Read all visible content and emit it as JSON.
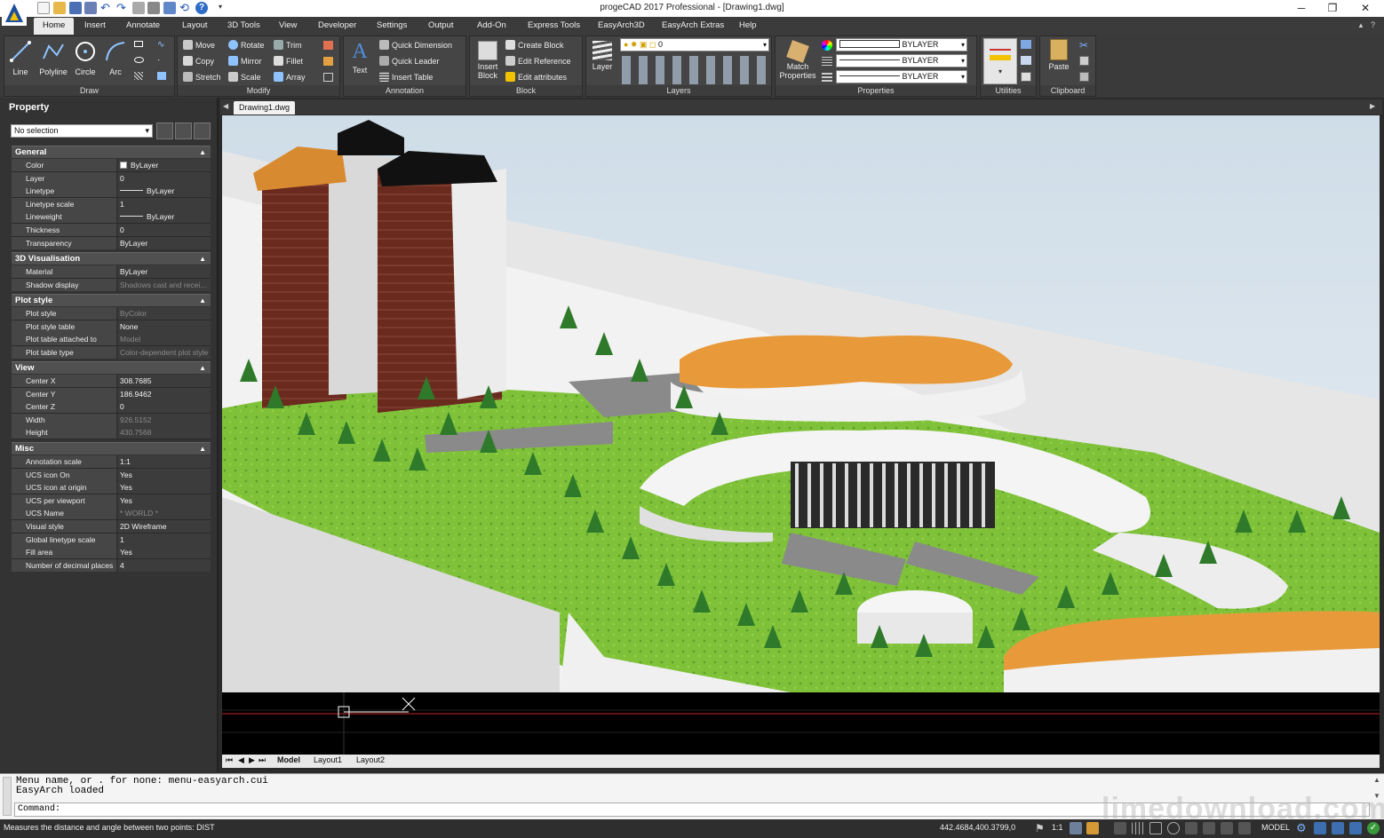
{
  "window": {
    "title": "progeCAD 2017 Professional - [Drawing1.dwg]",
    "minimize": "─",
    "restore": "❐",
    "close": "✕"
  },
  "menu": {
    "tabs": [
      {
        "label": "Home"
      },
      {
        "label": "Insert"
      },
      {
        "label": "Annotate"
      },
      {
        "label": "Layout"
      },
      {
        "label": "3D Tools"
      },
      {
        "label": "View"
      },
      {
        "label": "Developer"
      },
      {
        "label": "Settings"
      },
      {
        "label": "Output"
      },
      {
        "label": "Add-On"
      },
      {
        "label": "Express Tools"
      },
      {
        "label": "EasyArch3D"
      },
      {
        "label": "EasyArch Extras"
      },
      {
        "label": "Help"
      }
    ]
  },
  "ribbon": {
    "draw": {
      "label": "Draw",
      "line": "Line",
      "polyline": "Polyline",
      "circle": "Circle",
      "arc": "Arc"
    },
    "modify": {
      "label": "Modify",
      "move": "Move",
      "rotate": "Rotate",
      "trim": "Trim",
      "copy": "Copy",
      "mirror": "Mirror",
      "fillet": "Fillet",
      "stretch": "Stretch",
      "scale": "Scale",
      "array": "Array"
    },
    "annotation": {
      "label": "Annotation",
      "text": "Text",
      "quick_dimension": "Quick Dimension",
      "quick_leader": "Quick Leader",
      "insert_table": "Insert Table"
    },
    "block": {
      "label": "Block",
      "insert_block_1": "Insert",
      "insert_block_2": "Block",
      "create_block": "Create Block",
      "edit_reference": "Edit Reference",
      "edit_attributes": "Edit attributes"
    },
    "layers": {
      "label": "Layers",
      "layer": "Layer",
      "current_layer": "0"
    },
    "properties": {
      "label": "Properties",
      "match_1": "Match",
      "match_2": "Properties",
      "color": "BYLAYER",
      "linetype": "BYLAYER",
      "lineweight": "BYLAYER"
    },
    "utilities": {
      "label": "Utilities"
    },
    "clipboard": {
      "label": "Clipboard",
      "paste": "Paste"
    }
  },
  "property_panel": {
    "title": "Property",
    "selection": "No selection",
    "sections": {
      "general": {
        "title": "General",
        "rows": [
          {
            "k": "Color",
            "v": "ByLayer"
          },
          {
            "k": "Layer",
            "v": "0"
          },
          {
            "k": "Linetype",
            "v": "ByLayer"
          },
          {
            "k": "Linetype scale",
            "v": "1"
          },
          {
            "k": "Lineweight",
            "v": "ByLayer"
          },
          {
            "k": "Thickness",
            "v": "0"
          },
          {
            "k": "Transparency",
            "v": "ByLayer"
          }
        ]
      },
      "vis3d": {
        "title": "3D Visualisation",
        "rows": [
          {
            "k": "Material",
            "v": "ByLayer"
          },
          {
            "k": "Shadow display",
            "v": "Shadows cast and recei..."
          }
        ]
      },
      "plot": {
        "title": "Plot style",
        "rows": [
          {
            "k": "Plot style",
            "v": "ByColor"
          },
          {
            "k": "Plot style table",
            "v": "None"
          },
          {
            "k": "Plot table attached to",
            "v": "Model"
          },
          {
            "k": "Plot table type",
            "v": "Color-dependent plot style"
          }
        ]
      },
      "view": {
        "title": "View",
        "rows": [
          {
            "k": "Center X",
            "v": "308.7685"
          },
          {
            "k": "Center Y",
            "v": "186.9462"
          },
          {
            "k": "Center Z",
            "v": "0"
          },
          {
            "k": "Width",
            "v": "926.5152"
          },
          {
            "k": "Height",
            "v": "430.7568"
          }
        ]
      },
      "misc": {
        "title": "Misc",
        "rows": [
          {
            "k": "Annotation scale",
            "v": "1:1"
          },
          {
            "k": "UCS icon On",
            "v": "Yes"
          },
          {
            "k": "UCS icon at origin",
            "v": "Yes"
          },
          {
            "k": "UCS per viewport",
            "v": "Yes"
          },
          {
            "k": "UCS Name",
            "v": "* WORLD *"
          },
          {
            "k": "Visual style",
            "v": "2D Wireframe"
          },
          {
            "k": "Global linetype scale",
            "v": "1"
          },
          {
            "k": "Fill area",
            "v": "Yes"
          },
          {
            "k": "Number of decimal places",
            "v": "4"
          }
        ]
      }
    }
  },
  "document_tab": "Drawing1.dwg",
  "layout_tabs": {
    "model": "Model",
    "layout1": "Layout1",
    "layout2": "Layout2"
  },
  "command": {
    "line1": "Menu name, or . for none: menu-easyarch.cui",
    "line2": "EasyArch loaded",
    "prompt": "Command:"
  },
  "status": {
    "message": "Measures the distance and angle between two points:  DIST",
    "coords": "442.4684,400.3799,0",
    "scale": "1:1",
    "model": "MODEL"
  },
  "watermark": "limedownload.com"
}
